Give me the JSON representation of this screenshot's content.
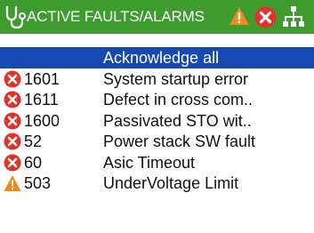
{
  "header": {
    "title": "ACTIVE FAULTS/ALARMS",
    "status_icons": [
      "warning-icon",
      "error-icon",
      "network-icon"
    ]
  },
  "colors": {
    "header_bg": "#3e9c2e",
    "selected_bg": "#1749b2",
    "error_red": "#e0342b",
    "warning_orange": "#f08a1c"
  },
  "list": {
    "items": [
      {
        "icon": "",
        "code": "",
        "text": "Acknowledge all",
        "selected": true
      },
      {
        "icon": "error-icon",
        "code": "1601",
        "text": "System startup error"
      },
      {
        "icon": "error-icon",
        "code": "1611",
        "text": "Defect in cross com.."
      },
      {
        "icon": "error-icon",
        "code": "1600",
        "text": "Passivated STO wit.."
      },
      {
        "icon": "error-icon",
        "code": "52",
        "text": "Power stack SW fault"
      },
      {
        "icon": "error-icon",
        "code": "60",
        "text": "Asic Timeout"
      },
      {
        "icon": "warning-icon",
        "code": "503",
        "text": "UnderVoltage Limit"
      }
    ]
  }
}
